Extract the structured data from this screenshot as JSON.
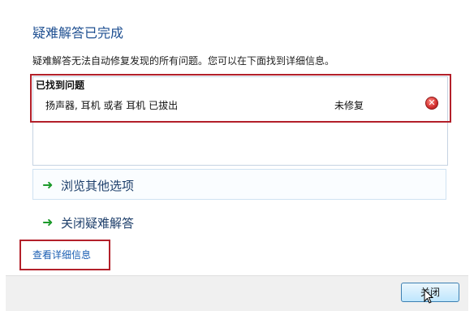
{
  "header": {
    "title": "疑难解答已完成"
  },
  "description": "疑难解答无法自动修复发现的所有问题。您可以在下面找到详细信息。",
  "problems": {
    "header": "已找到问题",
    "items": [
      {
        "name": "扬声器, 耳机 或者 耳机 已拔出",
        "status": "未修复",
        "icon": "error-icon"
      }
    ]
  },
  "options": [
    {
      "label": "浏览其他选项",
      "icon": "green-arrow-icon"
    },
    {
      "label": "关闭疑难解答",
      "icon": "green-arrow-icon"
    }
  ],
  "links": {
    "details": "查看详细信息"
  },
  "footer": {
    "close_label": "关闭"
  },
  "colors": {
    "highlight": "#b3202a",
    "title": "#1e4f91",
    "link": "#1c5fb3",
    "arrow": "#1c9a2b"
  }
}
